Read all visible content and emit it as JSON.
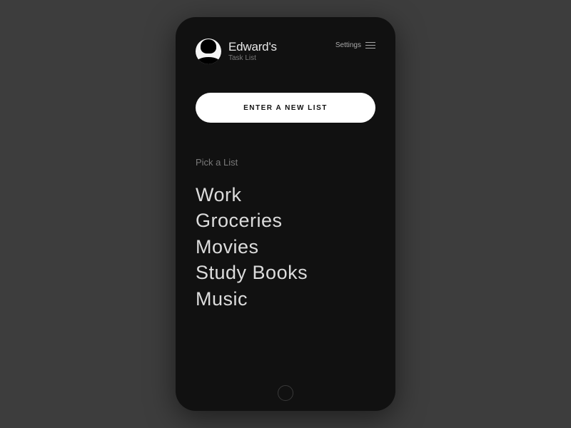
{
  "header": {
    "user_name": "Edward's",
    "subtitle": "Task List",
    "settings_label": "Settings"
  },
  "actions": {
    "new_list_label": "ENTER A NEW LIST"
  },
  "section": {
    "pick_label": "Pick a List"
  },
  "lists": [
    {
      "label": "Work"
    },
    {
      "label": "Groceries"
    },
    {
      "label": "Movies"
    },
    {
      "label": "Study Books"
    },
    {
      "label": "Music"
    }
  ]
}
